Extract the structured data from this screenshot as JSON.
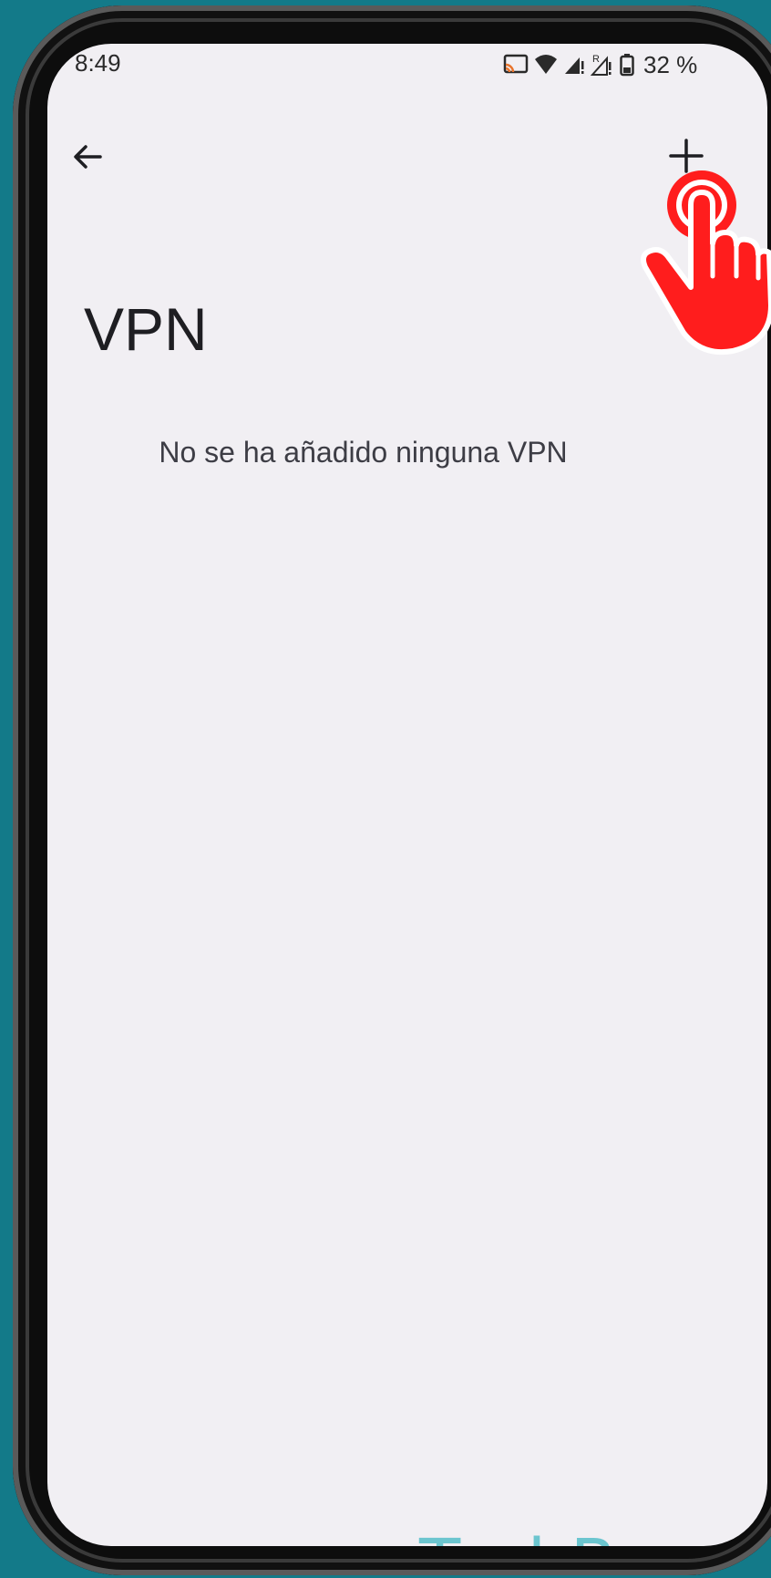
{
  "status_bar": {
    "time": "8:49",
    "battery": "32 %"
  },
  "app_bar": {
    "back_icon": "arrow-left-icon",
    "add_icon": "plus-icon"
  },
  "page": {
    "title": "VPN",
    "empty_message": "No se ha añadido ninguna VPN"
  },
  "watermark": {
    "text": "TechBone"
  },
  "colors": {
    "background": "#137a89",
    "screen": "#f1eff3",
    "accent_hand": "#ff1d1d",
    "watermark": "#5ec1cc"
  }
}
